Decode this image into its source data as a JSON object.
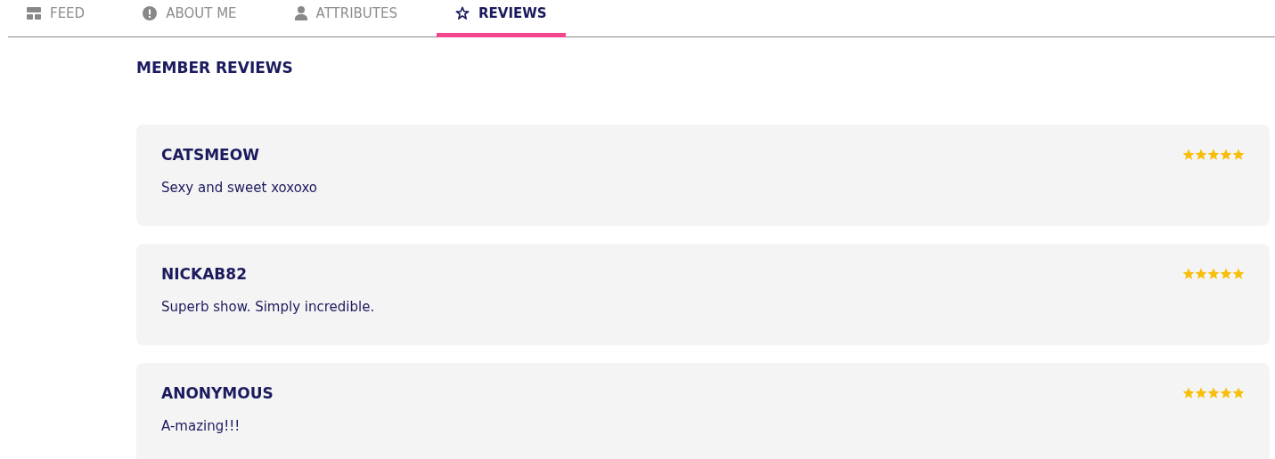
{
  "tabs": [
    {
      "label": "FEED",
      "kind": "feed",
      "selected": false
    },
    {
      "label": "ABOUT ME",
      "kind": "about",
      "selected": false
    },
    {
      "label": "ATTRIBUTES",
      "kind": "person",
      "selected": false
    },
    {
      "label": "REVIEWS",
      "kind": "star",
      "selected": true
    }
  ],
  "heading": "MEMBER REVIEWS",
  "reviews": [
    {
      "author": "CATSMEOW",
      "stars": 5,
      "text": "Sexy and sweet xoxoxo"
    },
    {
      "author": "NICKAB82",
      "stars": 5,
      "text": "Superb show. Simply incredible."
    },
    {
      "author": "ANONYMOUS",
      "stars": 5,
      "text": "A-mazing!!!"
    }
  ]
}
